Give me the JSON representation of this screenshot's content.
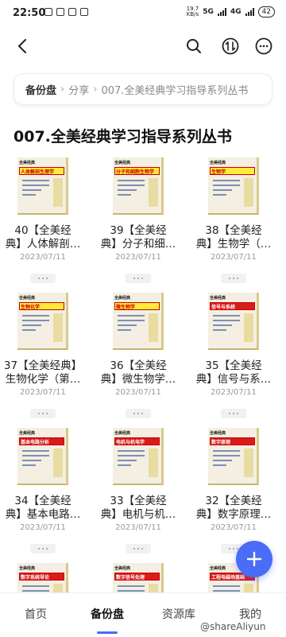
{
  "status_bar": {
    "time": "22:50",
    "net_speed_value": "19.7",
    "net_speed_unit": "KB/s",
    "signal_a": "5G",
    "signal_b": "4G",
    "battery": "42"
  },
  "nav": {
    "back_icon": "back-arrow-icon",
    "search_icon": "search-icon",
    "sort_icon": "sort-icon",
    "more_icon": "more-icon"
  },
  "breadcrumb": {
    "root": "备份盘",
    "separator": "›",
    "items": [
      "分享",
      "007.全美经典学习指导系列丛书"
    ]
  },
  "folder": {
    "title": "007.全美经典学习指导系列丛书"
  },
  "files": [
    {
      "name_line1": "40【全美经",
      "name_line2": "典】人体解剖…",
      "date": "2023/07/11",
      "cover_band": "人体解剖生理学",
      "band_style": "yellow"
    },
    {
      "name_line1": "39【全美经",
      "name_line2": "典】分子和细…",
      "date": "2023/07/11",
      "cover_band": "分子和细胞生物学",
      "band_style": "yellow"
    },
    {
      "name_line1": "38【全美经",
      "name_line2": "典】生物学（…",
      "date": "2023/07/11",
      "cover_band": "生物学",
      "band_style": "yellow"
    },
    {
      "name_line1": "37【全美经典】",
      "name_line2": "生物化学（第…",
      "date": "2023/07/11",
      "cover_band": "生物化学",
      "band_style": "yellow"
    },
    {
      "name_line1": "36【全美经",
      "name_line2": "典】微生物学…",
      "date": "2023/07/11",
      "cover_band": "微生物学",
      "band_style": "yellow"
    },
    {
      "name_line1": "35【全美经",
      "name_line2": "典】信号与系…",
      "date": "2023/07/11",
      "cover_band": "信号与系统",
      "band_style": "red"
    },
    {
      "name_line1": "34【全美经",
      "name_line2": "典】基本电路…",
      "date": "2023/07/11",
      "cover_band": "基本电路分析",
      "band_style": "red"
    },
    {
      "name_line1": "33【全美经",
      "name_line2": "典】电机与机…",
      "date": "2023/07/11",
      "cover_band": "电机与机电学",
      "band_style": "red"
    },
    {
      "name_line1": "32【全美经",
      "name_line2": "典】数字原理…",
      "date": "2023/07/11",
      "cover_band": "数字原理",
      "band_style": "red"
    },
    {
      "name_line1": "",
      "name_line2": "",
      "date": "",
      "cover_band": "数字系统导论",
      "band_style": "red"
    },
    {
      "name_line1": "",
      "name_line2": "",
      "date": "",
      "cover_band": "数字信号处理",
      "band_style": "red"
    },
    {
      "name_line1": "",
      "name_line2": "",
      "date": "",
      "cover_band": "工程电磁场基础",
      "band_style": "red"
    }
  ],
  "cover_series": "全美经典",
  "fab": {
    "icon": "plus-icon"
  },
  "tabbar": {
    "tabs": [
      "首页",
      "备份盘",
      "资源库",
      "我的"
    ],
    "active": "备份盘"
  },
  "watermark": "@shareAliyun",
  "colors": {
    "accent": "#4a6cf7"
  }
}
